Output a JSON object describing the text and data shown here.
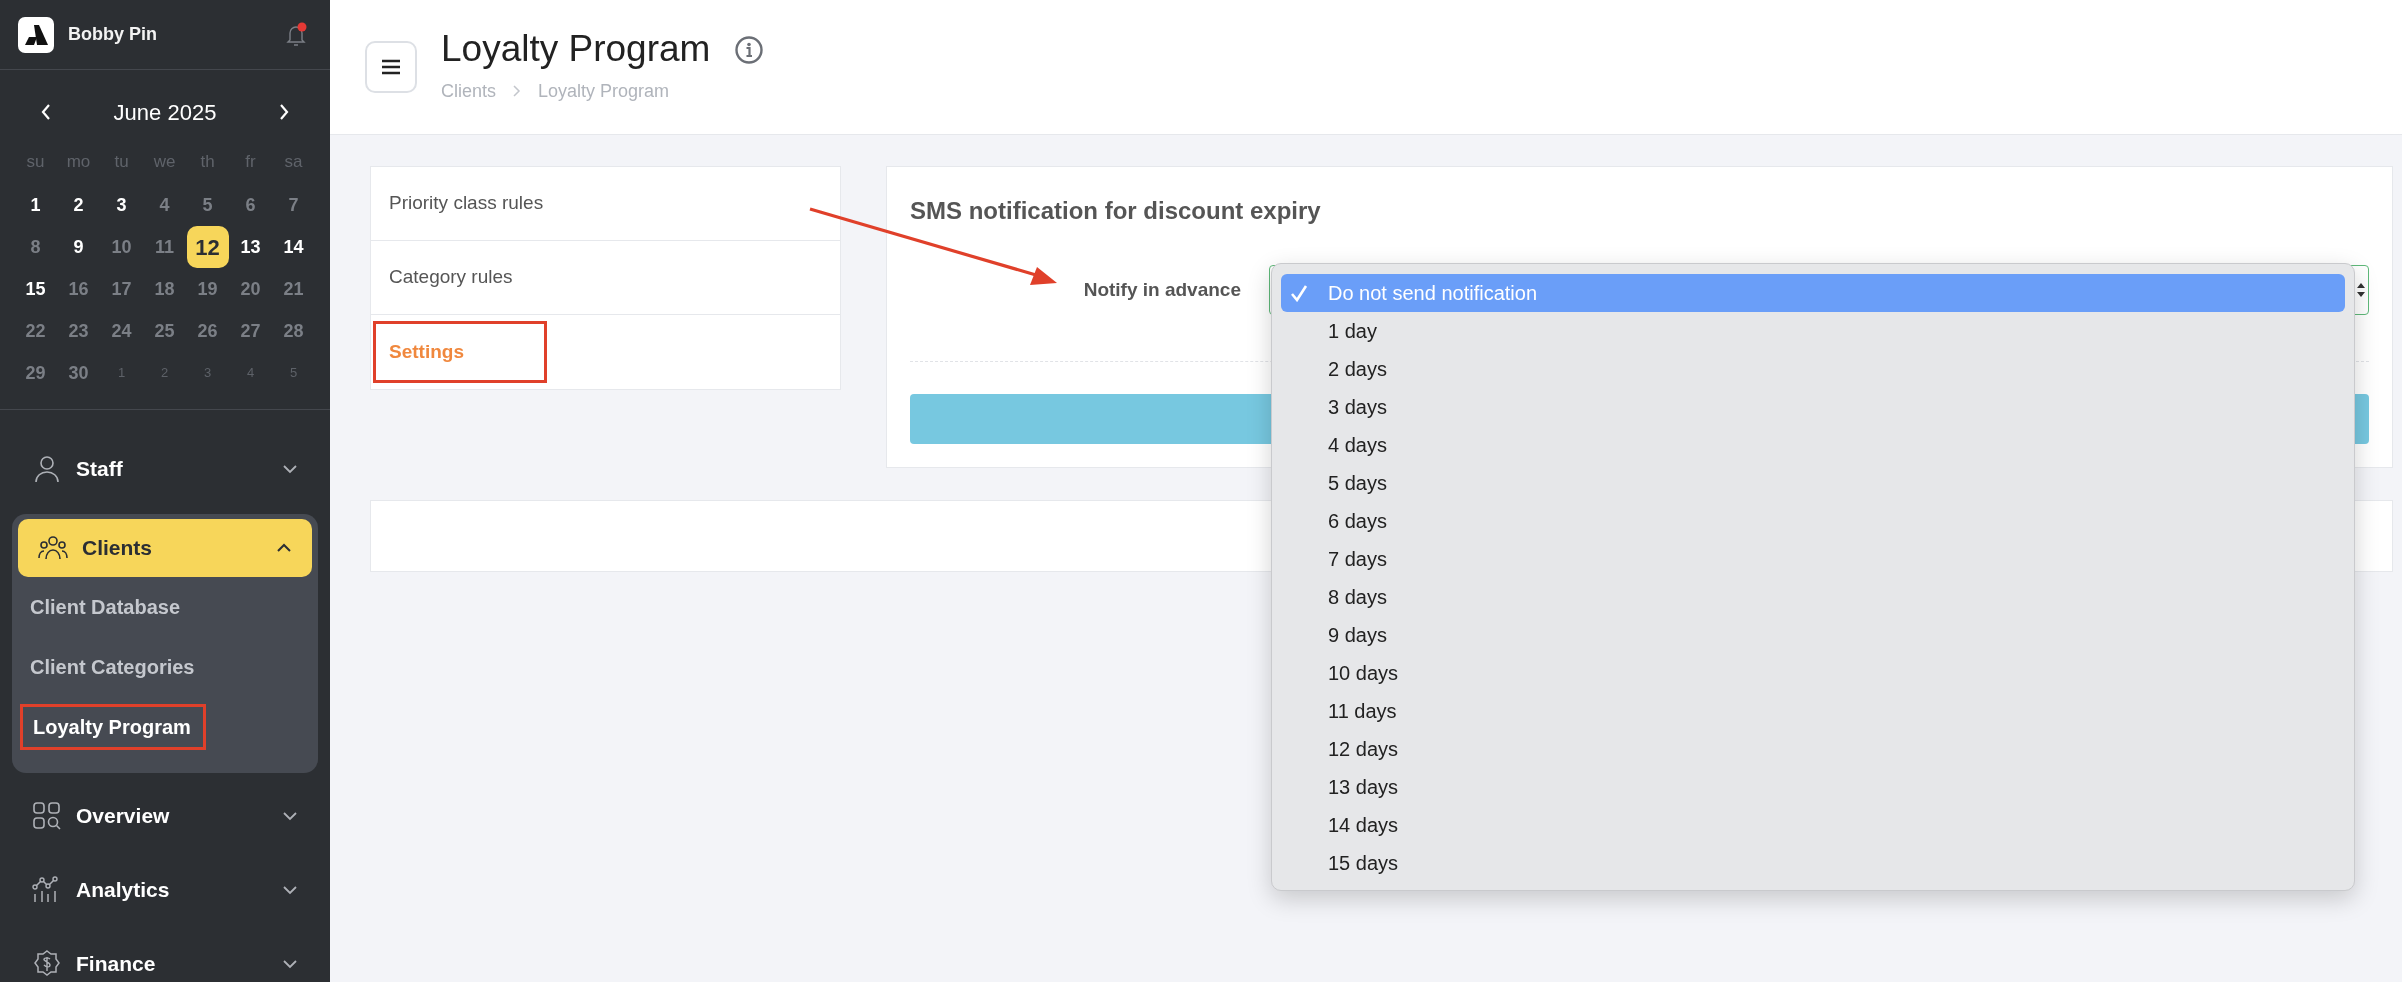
{
  "sidebar": {
    "account": {
      "name": "Bobby Pin",
      "has_notification": true
    },
    "calendar": {
      "month": "June 2025",
      "weekdays": [
        "su",
        "mo",
        "tu",
        "we",
        "th",
        "fr",
        "sa"
      ],
      "days": [
        {
          "label": "1",
          "kind": "marked",
          "selected": false
        },
        {
          "label": "2",
          "kind": "marked",
          "selected": false
        },
        {
          "label": "3",
          "kind": "marked",
          "selected": false
        },
        {
          "label": "4",
          "kind": "plain",
          "selected": false
        },
        {
          "label": "5",
          "kind": "plain",
          "selected": false
        },
        {
          "label": "6",
          "kind": "plain",
          "selected": false
        },
        {
          "label": "7",
          "kind": "plain",
          "selected": false
        },
        {
          "label": "8",
          "kind": "plain",
          "selected": false
        },
        {
          "label": "9",
          "kind": "marked",
          "selected": false
        },
        {
          "label": "10",
          "kind": "plain",
          "selected": false
        },
        {
          "label": "11",
          "kind": "plain",
          "selected": false
        },
        {
          "label": "12",
          "kind": "marked",
          "selected": true
        },
        {
          "label": "13",
          "kind": "marked",
          "selected": false
        },
        {
          "label": "14",
          "kind": "marked",
          "selected": false
        },
        {
          "label": "15",
          "kind": "marked",
          "selected": false
        },
        {
          "label": "16",
          "kind": "plain",
          "selected": false
        },
        {
          "label": "17",
          "kind": "plain",
          "selected": false
        },
        {
          "label": "18",
          "kind": "plain",
          "selected": false
        },
        {
          "label": "19",
          "kind": "plain",
          "selected": false
        },
        {
          "label": "20",
          "kind": "plain",
          "selected": false
        },
        {
          "label": "21",
          "kind": "plain",
          "selected": false
        },
        {
          "label": "22",
          "kind": "plain",
          "selected": false
        },
        {
          "label": "23",
          "kind": "plain",
          "selected": false
        },
        {
          "label": "24",
          "kind": "plain",
          "selected": false
        },
        {
          "label": "25",
          "kind": "plain",
          "selected": false
        },
        {
          "label": "26",
          "kind": "plain",
          "selected": false
        },
        {
          "label": "27",
          "kind": "plain",
          "selected": false
        },
        {
          "label": "28",
          "kind": "plain",
          "selected": false
        },
        {
          "label": "29",
          "kind": "plain",
          "selected": false
        },
        {
          "label": "30",
          "kind": "plain",
          "selected": false
        },
        {
          "label": "1",
          "kind": "adjacent",
          "selected": false
        },
        {
          "label": "2",
          "kind": "adjacent",
          "selected": false
        },
        {
          "label": "3",
          "kind": "adjacent",
          "selected": false
        },
        {
          "label": "4",
          "kind": "adjacent",
          "selected": false
        },
        {
          "label": "5",
          "kind": "adjacent",
          "selected": false
        }
      ]
    },
    "nav": [
      {
        "label": "Staff",
        "expanded": false,
        "selected": false
      },
      {
        "label": "Clients",
        "expanded": true,
        "selected": true,
        "children": [
          {
            "label": "Client Database",
            "selected": false,
            "highlighted": false
          },
          {
            "label": "Client Categories",
            "selected": false,
            "highlighted": false
          },
          {
            "label": "Loyalty Program",
            "selected": true,
            "highlighted": true
          }
        ]
      },
      {
        "label": "Overview",
        "expanded": false,
        "selected": false
      },
      {
        "label": "Analytics",
        "expanded": false,
        "selected": false
      },
      {
        "label": "Finance",
        "expanded": false,
        "selected": false
      }
    ]
  },
  "header": {
    "title": "Loyalty Program",
    "breadcrumb": [
      "Clients",
      "Loyalty Program"
    ]
  },
  "tabs": [
    {
      "label": "Priority class rules",
      "selected": false,
      "highlighted": false
    },
    {
      "label": "Category rules",
      "selected": false,
      "highlighted": false
    },
    {
      "label": "Settings",
      "selected": true,
      "highlighted": true
    }
  ],
  "sms_card": {
    "title": "SMS notification for discount expiry",
    "field_label": "Notify in advance",
    "select": {
      "options": [
        {
          "label": "Do not send notification",
          "selected": true
        },
        {
          "label": "1 day",
          "selected": false
        },
        {
          "label": "2 days",
          "selected": false
        },
        {
          "label": "3 days",
          "selected": false
        },
        {
          "label": "4 days",
          "selected": false
        },
        {
          "label": "5 days",
          "selected": false
        },
        {
          "label": "6 days",
          "selected": false
        },
        {
          "label": "7 days",
          "selected": false
        },
        {
          "label": "8 days",
          "selected": false
        },
        {
          "label": "9 days",
          "selected": false
        },
        {
          "label": "10 days",
          "selected": false
        },
        {
          "label": "11 days",
          "selected": false
        },
        {
          "label": "12 days",
          "selected": false
        },
        {
          "label": "13 days",
          "selected": false
        },
        {
          "label": "14 days",
          "selected": false
        },
        {
          "label": "15 days",
          "selected": false
        }
      ]
    }
  }
}
